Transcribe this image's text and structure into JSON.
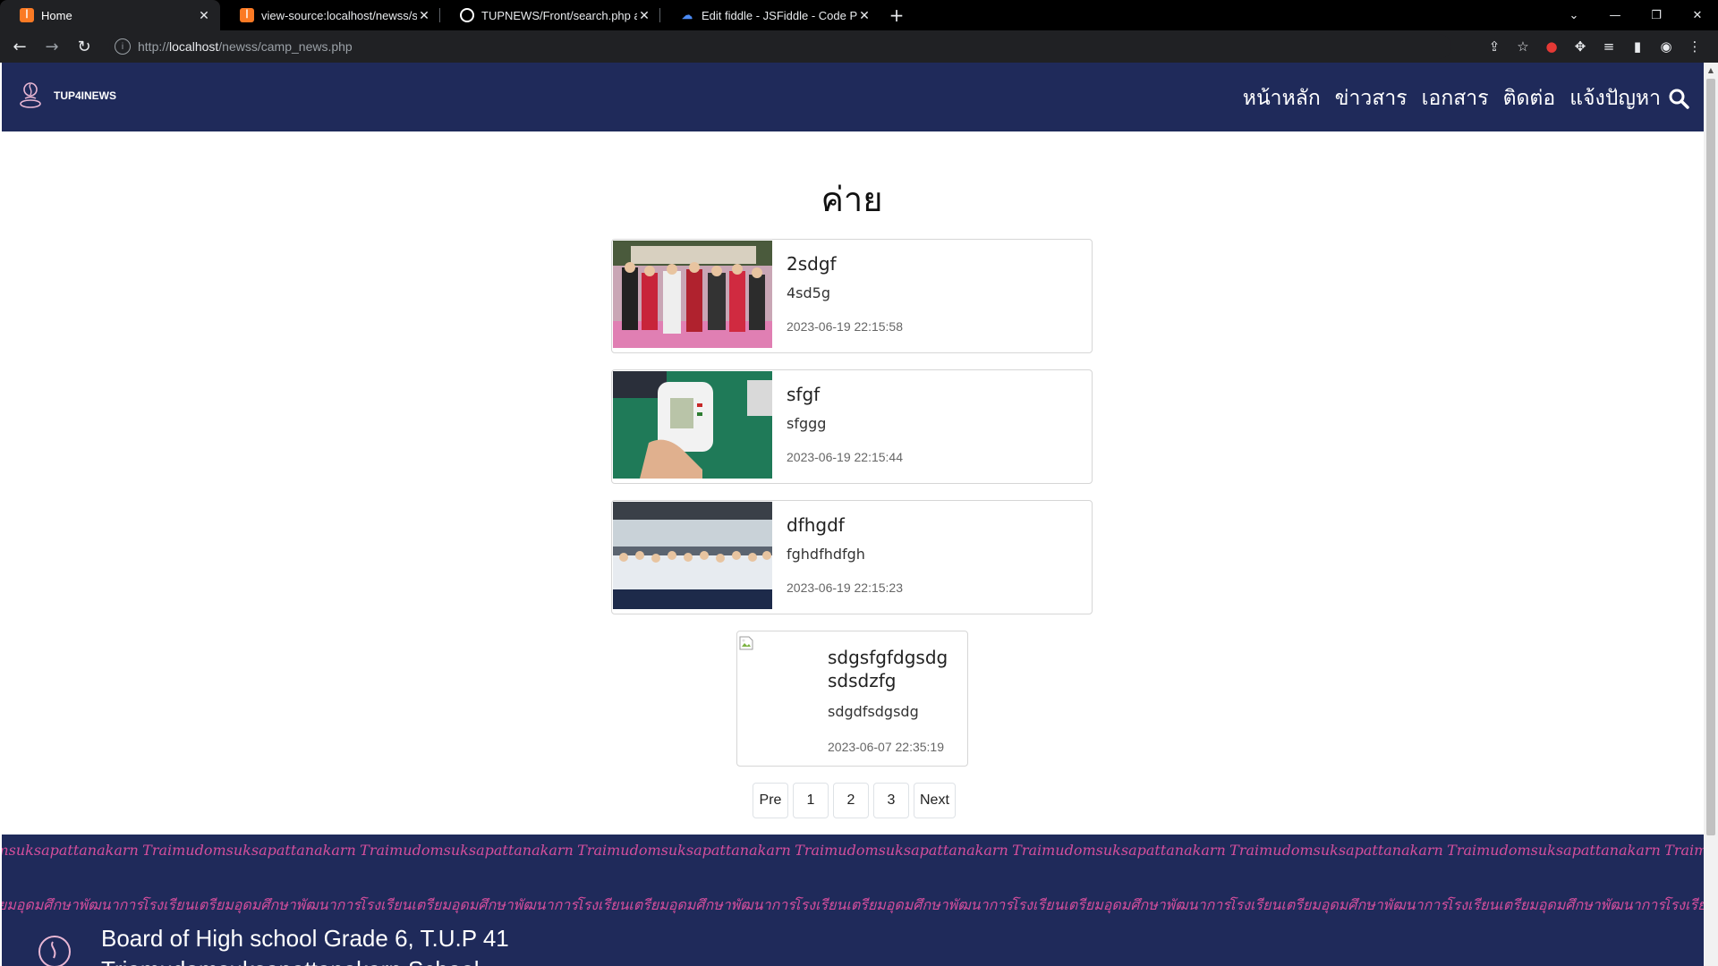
{
  "browser": {
    "tabs": [
      {
        "label": "Home",
        "icon": "xampp-icon",
        "active": true
      },
      {
        "label": "view-source:localhost/newss/search.php",
        "icon": "xampp-icon",
        "active": false
      },
      {
        "label": "TUPNEWS/Front/search.php at fr",
        "icon": "github-icon",
        "active": false
      },
      {
        "label": "Edit fiddle - JSFiddle - Code Playg",
        "icon": "jsfiddle-icon",
        "active": false
      }
    ],
    "new_tab": "+",
    "url_prefix": "http://",
    "url_host": "localhost",
    "url_path": "/newss/camp_news.php"
  },
  "site": {
    "brand": "TUP4INEWS",
    "nav": [
      "หน้าหลัก",
      "ข่าวสาร",
      "เอกสาร",
      "ติดต่อ",
      "แจ้งปัญหา"
    ]
  },
  "page": {
    "title": "ค่าย"
  },
  "posts": [
    {
      "title": "2sdgf",
      "desc": "4sd5g",
      "date": "2023-06-19 22:15:58"
    },
    {
      "title": "sfgf",
      "desc": "sfggg",
      "date": "2023-06-19 22:15:44"
    },
    {
      "title": "dfhgdf",
      "desc": "fghdfhdfgh",
      "date": "2023-06-19 22:15:23"
    },
    {
      "title": "sdgsfgfdgsdg sdsdzfg",
      "desc": "sdgdfsdgsdg",
      "date": "2023-06-07 22:35:19"
    }
  ],
  "pagination": [
    "Pre",
    "1",
    "2",
    "3",
    "Next"
  ],
  "footer": {
    "pattern_en": "Traimudomsuksapattanakarn",
    "pattern_th": "โรงเรียนเตรียมอุดมศึกษาพัฒนาการ",
    "title": "Board of High school Grade 6, T.U.P 41",
    "subtitle": "Triamudomsuksapattanakarn School"
  },
  "colors": {
    "header_bg": "#1f2a5a",
    "pattern_pink": "#d44e9c"
  }
}
